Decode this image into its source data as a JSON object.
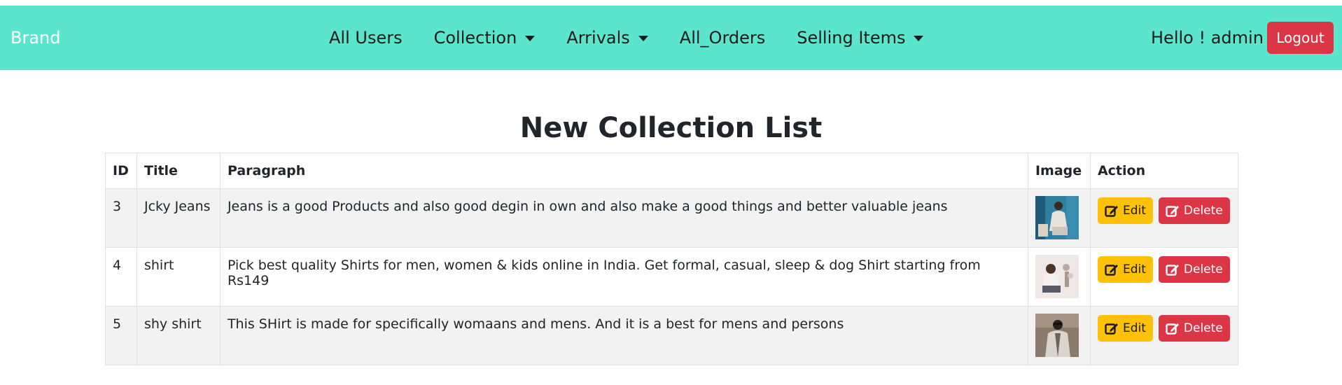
{
  "navbar": {
    "brand": "Brand",
    "links": [
      {
        "label": "All Users",
        "dropdown": false
      },
      {
        "label": "Collection",
        "dropdown": true
      },
      {
        "label": "Arrivals",
        "dropdown": true
      },
      {
        "label": "All_Orders",
        "dropdown": false
      },
      {
        "label": "Selling Items",
        "dropdown": true
      }
    ],
    "greeting": "Hello ! admin",
    "logout_label": "Logout"
  },
  "page": {
    "title": "New Collection List"
  },
  "table": {
    "headers": {
      "id": "ID",
      "title": "Title",
      "paragraph": "Paragraph",
      "image": "Image",
      "action": "Action"
    },
    "rows": [
      {
        "id": "3",
        "title": "Jcky Jeans",
        "paragraph": "Jeans is a good Products and also good degin in own and also make a good things and better valuable jeans",
        "edit_label": "Edit",
        "delete_label": "Delete"
      },
      {
        "id": "4",
        "title": "shirt",
        "paragraph": "Pick best quality Shirts for men, women & kids online in India. Get formal, casual, sleep & dog Shirt starting from Rs149",
        "edit_label": "Edit",
        "delete_label": "Delete"
      },
      {
        "id": "5",
        "title": "shy shirt",
        "paragraph": "This SHirt is made for specifically womaans and mens. And it is a best for mens and persons",
        "edit_label": "Edit",
        "delete_label": "Delete"
      }
    ]
  },
  "colors": {
    "navbar_bg": "#5ce5cd",
    "logout_bg": "#dc3545",
    "edit_bg": "#ffc107",
    "delete_bg": "#dc3545",
    "stripe_bg": "#f2f2f2"
  },
  "icons": {
    "dropdown": "caret-down-icon",
    "edit": "pencil-square-icon",
    "delete": "pencil-square-icon"
  }
}
